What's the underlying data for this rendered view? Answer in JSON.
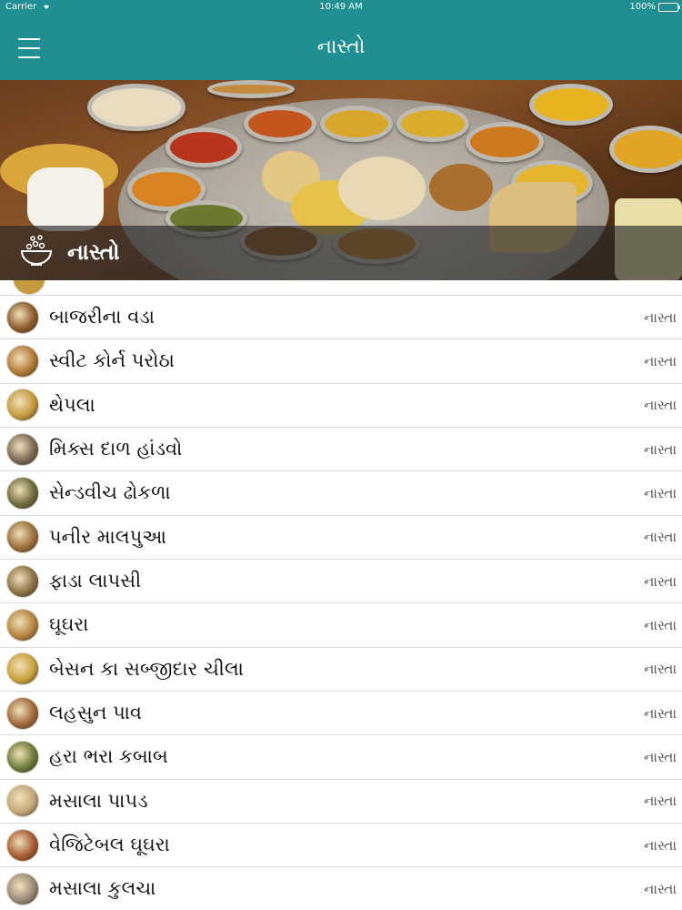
{
  "status_bar": {
    "carrier": "Carrier",
    "time": "10:49 AM",
    "battery": "100%"
  },
  "nav": {
    "title": "નાસ્તો",
    "menu_icon": "hamburger-menu-icon"
  },
  "banner": {
    "title": "નાસ્તો",
    "icon": "snack-bowl-icon"
  },
  "list": {
    "items": [
      {
        "title": "બાજરીના વડા",
        "category": "નાસ્તા",
        "thumb_color": "#8a5a2c"
      },
      {
        "title": "સ્વીટ કોર્ન પરોઠા",
        "category": "નાસ્તા",
        "thumb_color": "#b07a35"
      },
      {
        "title": "થેપલા",
        "category": "નાસ્તા",
        "thumb_color": "#c59a3e"
      },
      {
        "title": "મિક્સ દાળ હાંડવો",
        "category": "નાસ્તા",
        "thumb_color": "#7a6a55"
      },
      {
        "title": "સેન્ડવીચ ઢોકળા",
        "category": "નાસ્તા",
        "thumb_color": "#6e6a3a"
      },
      {
        "title": "પનીર માલપુઆ",
        "category": "નાસ્તા",
        "thumb_color": "#9a6d3a"
      },
      {
        "title": "ફાડા લાપસી",
        "category": "નાસ્તા",
        "thumb_color": "#8d7045"
      },
      {
        "title": "ઘૂઘરા",
        "category": "નાસ્તા",
        "thumb_color": "#b4843f"
      },
      {
        "title": "બેસન કા સબ્જીદાર ચીલા",
        "category": "નાસ્તા",
        "thumb_color": "#c8a23a"
      },
      {
        "title": "લહસુન પાવ",
        "category": "નાસ્તા",
        "thumb_color": "#a0683a"
      },
      {
        "title": "હરા ભરા કબાબ",
        "category": "નાસ્તા",
        "thumb_color": "#6d7a3a"
      },
      {
        "title": "મસાલા પાપડ",
        "category": "નાસ્તા",
        "thumb_color": "#c4a878"
      },
      {
        "title": "વેજિટેબલ ઘૂઘરા",
        "category": "નાસ્તા",
        "thumb_color": "#a65a30"
      },
      {
        "title": "મસાલા કુલચા",
        "category": "નાસ્તા",
        "thumb_color": "#9a8a7a"
      }
    ]
  },
  "colors": {
    "primary": "#1f8f92",
    "separator": "#dcdcdc"
  }
}
